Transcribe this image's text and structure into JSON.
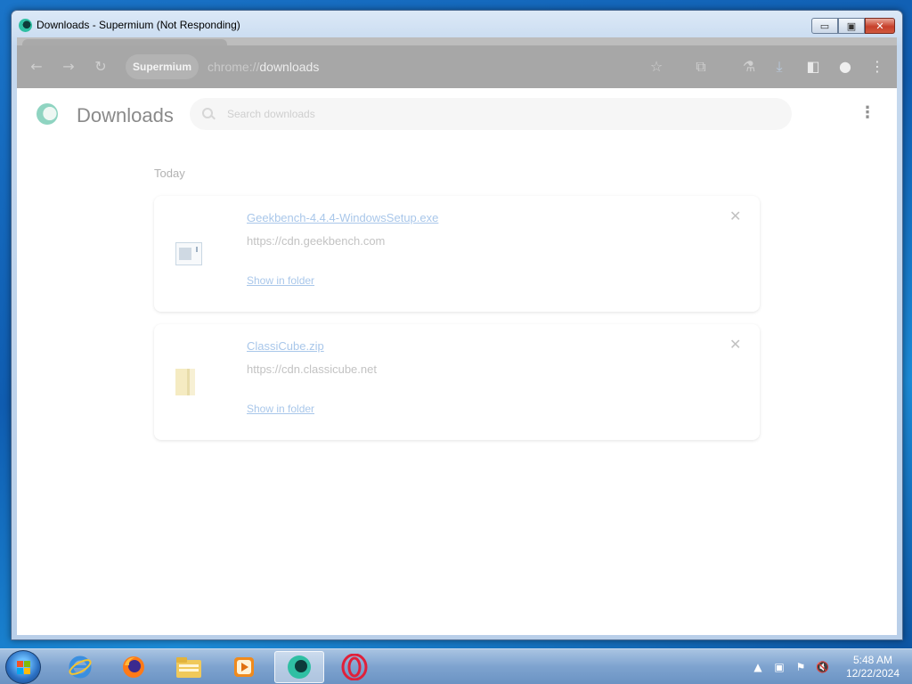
{
  "window": {
    "title": "Downloads - Supermium (Not Responding)",
    "caption": {
      "minimize": "▭",
      "maximize": "▣",
      "close": "✕"
    }
  },
  "toolbar": {
    "back_icon": "←",
    "forward_icon": "→",
    "reload_icon": "↻",
    "site_chip": "Supermium",
    "url_scheme": "chrome://",
    "url_path": "downloads",
    "bookmark_icon": "☆",
    "extensions_icon": "⧉",
    "labs_icon": "⚗",
    "download_icon": "⤓",
    "sidepanel_icon": "◧",
    "profile_icon": "●",
    "menu_icon": "⋮"
  },
  "page": {
    "title": "Downloads",
    "search_placeholder": "Search downloads",
    "menu_icon": "⋮",
    "section": "Today",
    "items": [
      {
        "name": "Geekbench-4.4.4-WindowsSetup.exe",
        "url": "https://cdn.geekbench.com",
        "action": "Show in folder",
        "remove": "✕",
        "icon": "exe-file-icon"
      },
      {
        "name": "ClassiCube.zip",
        "url": "https://cdn.classicube.net",
        "action": "Show in folder",
        "remove": "✕",
        "icon": "zip-folder-icon"
      }
    ]
  },
  "taskbar": {
    "apps": [
      "internet-explorer-icon",
      "firefox-icon",
      "file-explorer-icon",
      "media-player-icon",
      "supermium-icon",
      "opera-icon"
    ],
    "tray": {
      "arrow": "▲",
      "network": "▣",
      "flag": "⚑",
      "volume": "🔇"
    },
    "time": "5:48 AM",
    "date": "12/22/2024"
  }
}
